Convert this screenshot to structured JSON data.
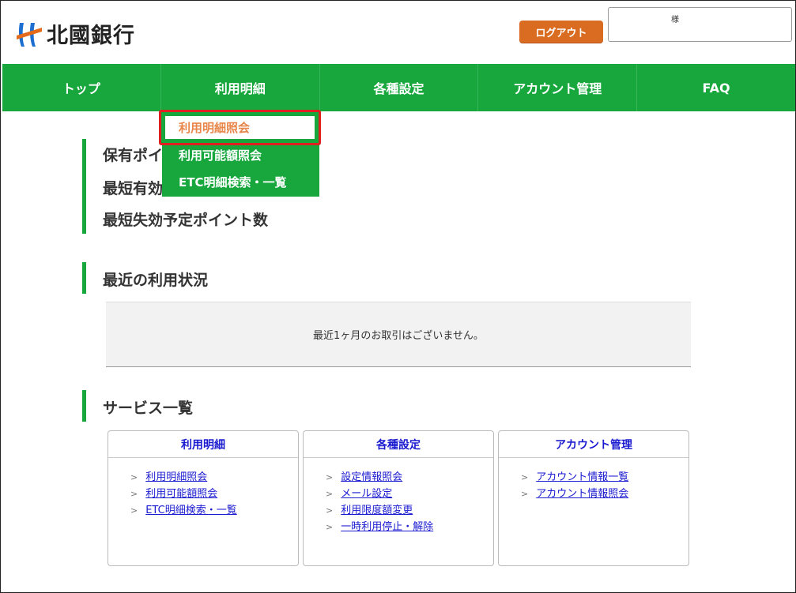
{
  "header": {
    "logo_text": "北國銀行",
    "logout_label": "ログアウト",
    "user_suffix": "様"
  },
  "nav": {
    "items": [
      "トップ",
      "利用明細",
      "各種設定",
      "アカウント管理",
      "FAQ"
    ]
  },
  "dropdown": {
    "items": [
      "利用明細照会",
      "利用可能額照会",
      "ETC明細検索・一覧"
    ]
  },
  "points": {
    "lines": [
      "保有ポイ",
      "最短有効",
      "最短失効予定ポイント数"
    ]
  },
  "recent": {
    "title": "最近の利用状況",
    "empty_message": "最近1ヶ月のお取引はございません。"
  },
  "services": {
    "title": "サービス一覧",
    "cards": [
      {
        "title": "利用明細",
        "links": [
          "利用明細照会",
          "利用可能額照会",
          "ETC明細検索・一覧"
        ]
      },
      {
        "title": "各種設定",
        "links": [
          "設定情報照会",
          "メール設定",
          "利用限度額変更",
          "一時利用停止・解除"
        ]
      },
      {
        "title": "アカウント管理",
        "links": [
          "アカウント情報一覧",
          "アカウント情報照会"
        ]
      }
    ]
  },
  "colors": {
    "brand_green": "#17a73d",
    "logout_orange": "#d96c20",
    "highlight_red": "#e02020",
    "link_blue": "#1a1ad0"
  }
}
